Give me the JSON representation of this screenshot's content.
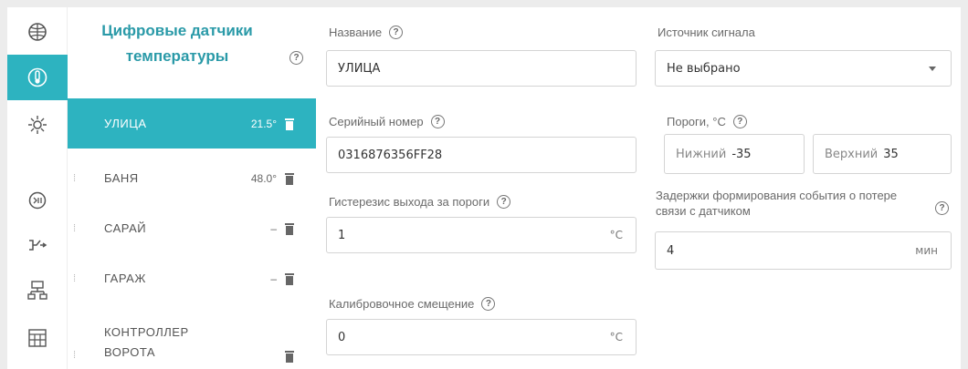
{
  "colors": {
    "accent": "#2db3c0",
    "title": "#2a9aa8"
  },
  "rail": {
    "items": [
      {
        "icon": "globe-icon",
        "active": false
      },
      {
        "icon": "thermometer-icon",
        "active": true
      },
      {
        "icon": "sun-icon",
        "active": false
      },
      {
        "icon": "input-icon",
        "active": false
      },
      {
        "icon": "relay-icon",
        "active": false
      },
      {
        "icon": "network-icon",
        "active": false
      },
      {
        "icon": "panel-icon",
        "active": false
      }
    ]
  },
  "list": {
    "title": "Цифровые датчики температуры",
    "items": [
      {
        "name": "УЛИЦА",
        "temp": "21.5°",
        "selected": true
      },
      {
        "name": "БАНЯ",
        "temp": "48.0°",
        "selected": false
      },
      {
        "name": "САРАЙ",
        "temp": "–",
        "selected": false
      },
      {
        "name": "ГАРАЖ",
        "temp": "–",
        "selected": false
      },
      {
        "name": "КОНТРОЛЛЕР ВОРОТА",
        "temp": "",
        "selected": false
      }
    ]
  },
  "form": {
    "name": {
      "label": "Название",
      "value": "УЛИЦА"
    },
    "serial": {
      "label": "Серийный номер",
      "value": "0316876356FF28"
    },
    "hysteresis": {
      "label": "Гистерезис выхода за пороги",
      "value": "1",
      "unit": "°C"
    },
    "calibration": {
      "label": "Калибровочное смещение",
      "value": "0",
      "unit": "°C"
    },
    "source": {
      "label": "Источник сигнала",
      "value": "Не выбрано"
    },
    "thresholds": {
      "label": "Пороги, °C",
      "lower": {
        "label": "Нижний",
        "value": "-35"
      },
      "upper": {
        "label": "Верхний",
        "value": "35"
      }
    },
    "delay": {
      "label": "Задержки формирования события о потере связи с датчиком",
      "value": "4",
      "unit": "мин"
    }
  }
}
